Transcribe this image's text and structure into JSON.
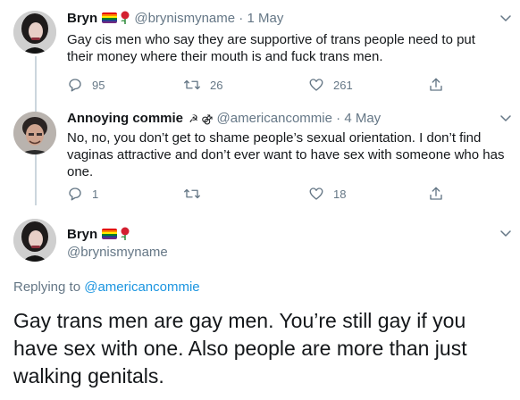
{
  "tweets": [
    {
      "display_name": "Bryn",
      "handle": "@brynismyname",
      "separator": "·",
      "date": "1 May",
      "text": "Gay cis men who say they are supportive of trans people need to put their money where their mouth is and fuck trans men.",
      "reply_count": "95",
      "retweet_count": "26",
      "like_count": "261"
    },
    {
      "display_name": "Annoying commie",
      "name_emoji": "☭ ⚣",
      "handle": "@americancommie",
      "separator": "·",
      "date": "4 May",
      "text": "No, no, you don’t get to shame people’s sexual orientation. I don’t find vaginas attractive and don’t ever want to have sex with someone who has one.",
      "reply_count": "1",
      "retweet_count": "",
      "like_count": "18"
    }
  ],
  "focused": {
    "display_name": "Bryn",
    "handle": "@brynismyname",
    "replying_prefix": "Replying to",
    "replying_to": "@americancommie",
    "text": "Gay trans men are gay men. You’re still gay if you have sex with one. Also people are more than just walking genitals."
  },
  "colors": {
    "text": "#14171a",
    "secondary": "#657786",
    "link": "#1b95e0",
    "thread_line": "#ccd6dd"
  },
  "icons": [
    "reply-icon",
    "retweet-icon",
    "like-icon",
    "share-icon",
    "chevron-down-icon",
    "rainbow-flag-icon",
    "rose-icon"
  ]
}
